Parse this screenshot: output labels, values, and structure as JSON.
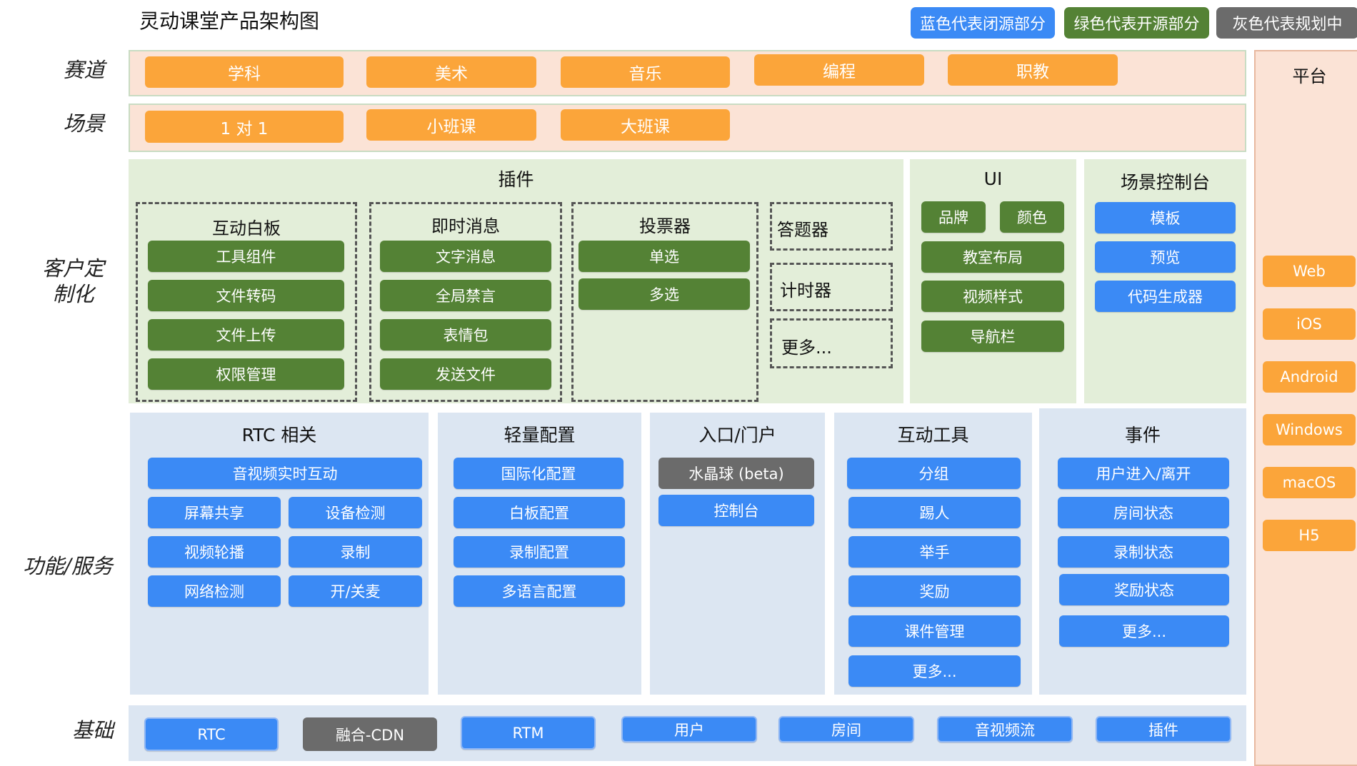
{
  "title": "灵动课堂产品架构图",
  "legend": {
    "blue": "蓝色代表闭源部分",
    "green": "绿色代表开源部分",
    "gray": "灰色代表规划中"
  },
  "colors": {
    "blue": "#3b8af5",
    "green": "#548235",
    "gray": "#6b6b6b",
    "orange": "#fba53a",
    "peach": "#fbe3d6",
    "light_green": "#e3eed9",
    "light_blue": "#dce6f2"
  },
  "row_labels": {
    "track": "赛道",
    "scene": "场景",
    "custom": "客户定制化",
    "service": "功能/服务",
    "base": "基础"
  },
  "tracks": [
    "学科",
    "美术",
    "音乐",
    "编程",
    "职教"
  ],
  "scenes": [
    "1 对 1",
    "小班课",
    "大班课"
  ],
  "plugins": {
    "title": "插件",
    "whiteboard": {
      "title": "互动白板",
      "items": [
        "工具组件",
        "文件转码",
        "文件上传",
        "权限管理"
      ]
    },
    "im": {
      "title": "即时消息",
      "items": [
        "文字消息",
        "全局禁言",
        "表情包",
        "发送文件"
      ]
    },
    "vote": {
      "title": "投票器",
      "items": [
        "单选",
        "多选"
      ]
    },
    "quiz": "答题器",
    "timer": "计时器",
    "more": "更多..."
  },
  "ui": {
    "title": "UI",
    "items": [
      "品牌",
      "颜色",
      "教室布局",
      "视频样式",
      "导航栏"
    ]
  },
  "scene_console": {
    "title": "场景控制台",
    "items": [
      "模板",
      "预览",
      "代码生成器"
    ]
  },
  "rtc": {
    "title": "RTC 相关",
    "main": "音视频实时互动",
    "items": [
      "屏幕共享",
      "设备检测",
      "视频轮播",
      "录制",
      "网络检测",
      "开/关麦"
    ]
  },
  "config": {
    "title": "轻量配置",
    "items": [
      "国际化配置",
      "白板配置",
      "录制配置",
      "多语言配置"
    ]
  },
  "entry": {
    "title": "入口/门户",
    "items": [
      "水晶球 (beta)",
      "控制台"
    ]
  },
  "tools": {
    "title": "互动工具",
    "items": [
      "分组",
      "踢人",
      "举手",
      "奖励",
      "课件管理",
      "更多..."
    ]
  },
  "events": {
    "title": "事件",
    "items": [
      "用户进入/离开",
      "房间状态",
      "录制状态",
      "奖励状态",
      "更多..."
    ]
  },
  "base": [
    "RTC",
    "融合-CDN",
    "RTM",
    "用户",
    "房间",
    "音视频流",
    "插件"
  ],
  "platform": {
    "title": "平台",
    "items": [
      "Web",
      "iOS",
      "Android",
      "Windows",
      "macOS",
      "H5"
    ]
  }
}
